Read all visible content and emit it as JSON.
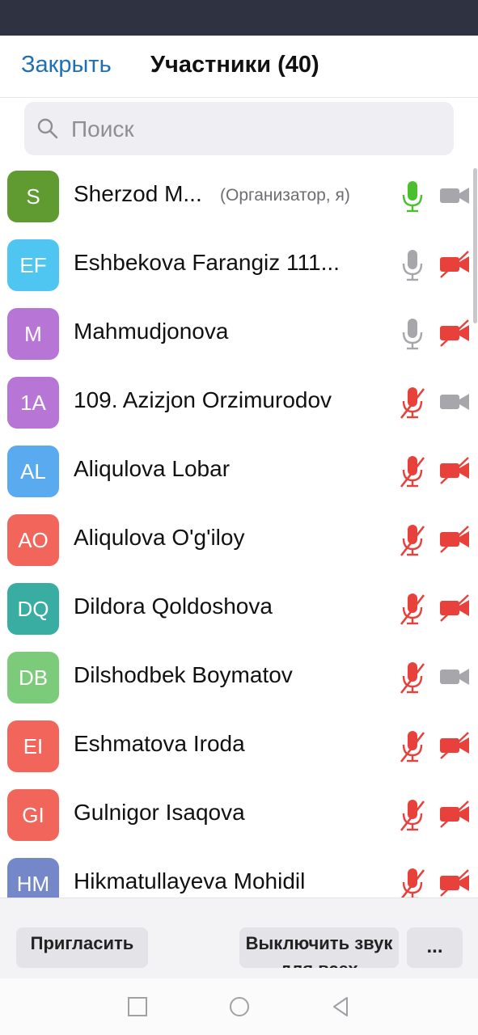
{
  "header": {
    "close_label": "Закрыть",
    "title": "Участники (40)"
  },
  "search": {
    "placeholder": "Поиск"
  },
  "participants": [
    {
      "initials": "S",
      "name": "Sherzod M...",
      "role": "(Организатор, я)",
      "avatar_color": "#5f9b30",
      "mic": "active",
      "video": "on"
    },
    {
      "initials": "EF",
      "name": "Eshbekova Farangiz 111...",
      "role": "",
      "avatar_color": "#4fc6f2",
      "mic": "on",
      "video": "off"
    },
    {
      "initials": "M",
      "name": "Mahmudjonova",
      "role": "",
      "avatar_color": "#b776d6",
      "mic": "on",
      "video": "off"
    },
    {
      "initials": "1A",
      "name": "109. Azizjon Orzimurodov",
      "role": "",
      "avatar_color": "#b776d6",
      "mic": "muted",
      "video": "on"
    },
    {
      "initials": "AL",
      "name": "Aliqulova Lobar",
      "role": "",
      "avatar_color": "#5aaaf0",
      "mic": "muted",
      "video": "off"
    },
    {
      "initials": "AO",
      "name": "Aliqulova O'g'iloy",
      "role": "",
      "avatar_color": "#f2655a",
      "mic": "muted",
      "video": "off"
    },
    {
      "initials": "DQ",
      "name": "Dildora Qoldoshova",
      "role": "",
      "avatar_color": "#3aada2",
      "mic": "muted",
      "video": "off"
    },
    {
      "initials": "DB",
      "name": "Dilshodbek Boymatov",
      "role": "",
      "avatar_color": "#7ccb7a",
      "mic": "muted",
      "video": "on"
    },
    {
      "initials": "EI",
      "name": "Eshmatova Iroda",
      "role": "",
      "avatar_color": "#f2655a",
      "mic": "muted",
      "video": "off"
    },
    {
      "initials": "GI",
      "name": "Gulnigor Isaqova",
      "role": "",
      "avatar_color": "#f2655a",
      "mic": "muted",
      "video": "off"
    },
    {
      "initials": "HM",
      "name": "Hikmatullayeva Mohidil",
      "role": "",
      "avatar_color": "#7487c8",
      "mic": "muted",
      "video": "off"
    }
  ],
  "actions": {
    "invite_label": "Пригласить",
    "mute_all_label": "Выключить звук для всех",
    "more_label": "..."
  },
  "colors": {
    "mic_active": "#4cbf2f",
    "icon_gray": "#a7a7ab",
    "muted_red": "#e8413c",
    "link_blue": "#1f6fb5"
  },
  "icons": {
    "search": "search-icon",
    "mic": "microphone-icon",
    "mic_muted": "microphone-muted-icon",
    "video": "video-camera-icon",
    "video_off": "video-camera-off-icon"
  }
}
